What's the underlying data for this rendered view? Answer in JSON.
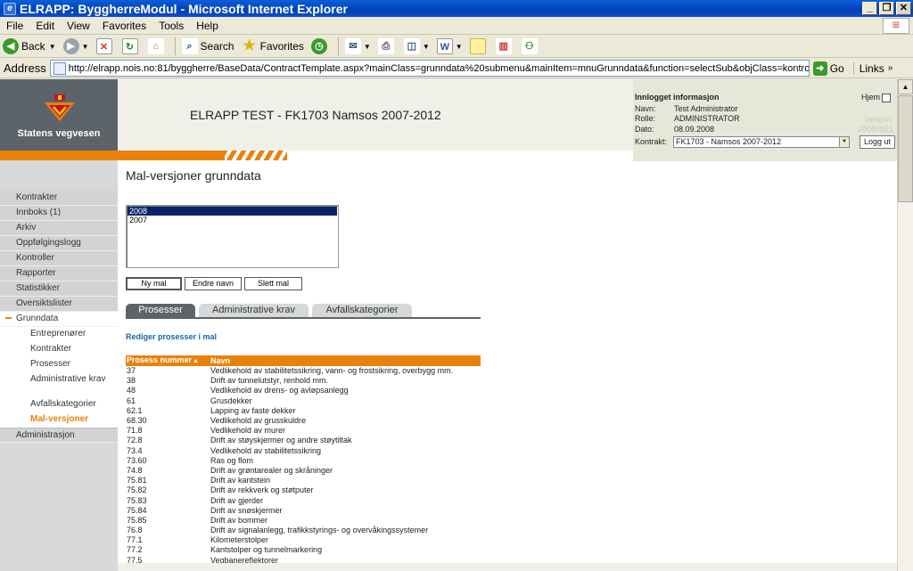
{
  "window": {
    "title": "ELRAPP: ByggherreModul - Microsoft Internet Explorer"
  },
  "menu": [
    "File",
    "Edit",
    "View",
    "Favorites",
    "Tools",
    "Help"
  ],
  "toolbar": {
    "back": "Back",
    "search": "Search",
    "favorites": "Favorites"
  },
  "address": {
    "label": "Address",
    "url": "http://elrapp.nois.no:81/byggherre/BaseData/ContractTemplate.aspx?mainClass=grunndata%20submenu&mainItem=mnuGrunndata&function=selectSub&objClass=kontroll&sel",
    "go": "Go",
    "links": "Links"
  },
  "header": {
    "org_name": "Statens vegvesen",
    "app_title": "ELRAPP TEST - FK1703 Namsos 2007-2012"
  },
  "login": {
    "heading": "Innlogget informasjon",
    "hjem": "Hjem",
    "navn_label": "Navn:",
    "navn": "Test Administrator",
    "rolle_label": "Rolle:",
    "rolle": "ADMINISTRATOR",
    "dato_label": "Dato:",
    "dato": "08.09.2008",
    "versjon_label": "Versjon:",
    "versjon": "20080821",
    "kontrakt_label": "Kontrakt:",
    "kontrakt": "FK1703 - Namsos 2007-2012",
    "logout": "Logg ut"
  },
  "nav": [
    {
      "label": "Kontrakter"
    },
    {
      "label": "Innboks (1)"
    },
    {
      "label": "Arkiv"
    },
    {
      "label": "Oppfølgingslogg"
    },
    {
      "label": "Kontroller"
    },
    {
      "label": "Rapporter"
    },
    {
      "label": "Statistikker"
    },
    {
      "label": "Oversiktslister"
    },
    {
      "label": "Grunndata"
    },
    {
      "label": "Administrasjon"
    }
  ],
  "subnav": [
    {
      "label": "Entreprenører"
    },
    {
      "label": "Kontrakter"
    },
    {
      "label": "Prosesser"
    },
    {
      "label": "Administrative krav"
    },
    {
      "label": "Avfallskategorier"
    },
    {
      "label": "Mal-versjoner"
    }
  ],
  "main": {
    "title": "Mal-versjoner grunndata",
    "versions": [
      "2008",
      "2007"
    ],
    "selected_version": "2008",
    "buttons": {
      "new": "Ny mal",
      "rename": "Endre navn",
      "delete": "Slett mal"
    },
    "tabs": [
      "Prosesser",
      "Administrative krav",
      "Avfallskategorier"
    ],
    "active_tab": "Prosesser",
    "edit_link": "Rediger prosesser i mal",
    "table": {
      "columns": [
        "Prosess nummer",
        "Navn"
      ],
      "rows": [
        [
          "37",
          "Vedlikehold av stabilitetssikring, vann- og frostsikring, overbygg mm."
        ],
        [
          "38",
          "Drift av tunnelutstyr, renhold mm."
        ],
        [
          "48",
          "Vedlikehold av drens- og avløpsanlegg"
        ],
        [
          "61",
          "Grusdekker"
        ],
        [
          "62.1",
          "Lapping av faste dekker"
        ],
        [
          "68.30",
          "Vedlikehold av grusskuldre"
        ],
        [
          "71.8",
          "Vedlikehold av murer"
        ],
        [
          "72.8",
          "Drift av støyskjermer og andre støytiltak"
        ],
        [
          "73.4",
          "Vedlikehold av stabilitetssikring"
        ],
        [
          "73.60",
          "Ras og flom"
        ],
        [
          "74.8",
          "Drift av grøntarealer og skråninger"
        ],
        [
          "75.81",
          "Drift av kantstein"
        ],
        [
          "75.82",
          "Drift av rekkverk og støtputer"
        ],
        [
          "75.83",
          "Drift av gjerder"
        ],
        [
          "75.84",
          "Drift av snøskjermer"
        ],
        [
          "75.85",
          "Drift av bommer"
        ],
        [
          "76.8",
          "Drift av signalanlegg, trafikkstyrings- og overvåkingssystemer"
        ],
        [
          "77.1",
          "Kilometerstolper"
        ],
        [
          "77.2",
          "Kantstolper og tunnelmarkering"
        ],
        [
          "77.5",
          "Vegbanereflektorer"
        ]
      ]
    }
  }
}
